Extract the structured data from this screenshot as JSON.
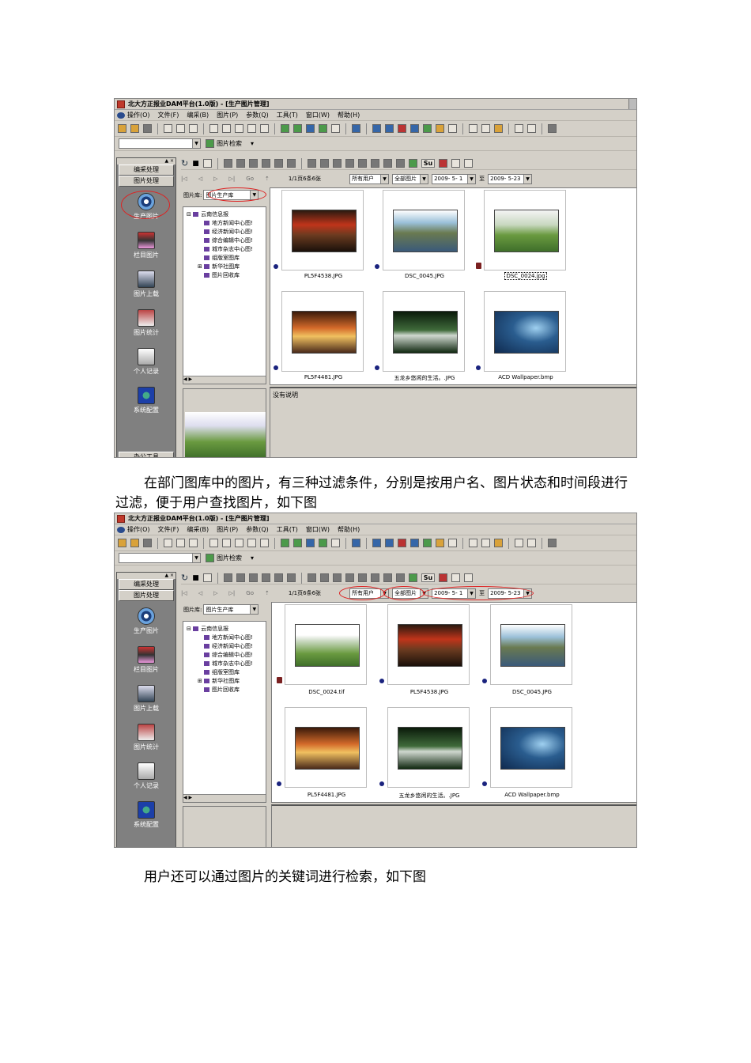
{
  "shot1": {
    "title": "北大方正报业DAM平台(1.0版) - [生产图片管理]",
    "menus": [
      "操作(O)",
      "文件(F)",
      "编采(B)",
      "图片(P)",
      "参数(Q)",
      "工具(T)",
      "窗口(W)",
      "帮助(H)"
    ],
    "search_button": "图片检索",
    "tabs": [
      "编采处理",
      "图片处理"
    ],
    "nav": [
      "生产图片",
      "栏目图片",
      "图片上载",
      "图片统计",
      "个人记录",
      "系统配置"
    ],
    "office_tools": "办公工具",
    "go_label": "Go",
    "page_info": "1/1页6条6张",
    "filter_user": "所有用户",
    "filter_state": "全部图片",
    "date_from": "2009- 5- 1",
    "date_to_label": "至",
    "date_to": "2009- 5-23",
    "library_label": "图片库:",
    "library_value": "图片生产库",
    "tree_root": "云南信息报",
    "tree_items": [
      "地方新闻中心图!",
      "经济新闻中心图!",
      "综合编辑中心图!",
      "城市杂志中心图!",
      "组版室图库",
      "新华社图库",
      "图片回收库"
    ],
    "thumbs": [
      "PL5F4538.JPG",
      "DSC_0045.JPG",
      "DSC_0024.jpg",
      "PL5F4481.JPG",
      "五龙乡悠闲的生活。.JPG",
      "ACD Wallpaper.bmp"
    ],
    "desc": "没有说明"
  },
  "para1": "在部门图库中的图片，有三种过滤条件，分别是按用户名、图片状态和时间段进行过滤，便于用户查找图片，如下图",
  "shot2": {
    "title": "北大方正报业DAM平台(1.0版) - [生产图片管理]",
    "menus": [
      "操作(O)",
      "文件(F)",
      "编采(B)",
      "图片(P)",
      "参数(Q)",
      "工具(T)",
      "窗口(W)",
      "帮助(H)"
    ],
    "search_button": "图片检索",
    "tabs": [
      "编采处理",
      "图片处理"
    ],
    "nav": [
      "生产图片",
      "栏目图片",
      "图片上载",
      "图片统计",
      "个人记录",
      "系统配置"
    ],
    "go_label": "Go",
    "page_info": "1/1页6条6张",
    "filter_user": "所有用户",
    "filter_state": "全部图片",
    "date_from": "2009- 5- 1",
    "date_to_label": "至",
    "date_to": "2009- 5-23",
    "library_label": "图片库:",
    "library_value": "图片生产库",
    "tree_root": "云南信息报",
    "tree_items": [
      "地方新闻中心图!",
      "经济新闻中心图!",
      "综合编辑中心图!",
      "城市杂志中心图!",
      "组版室图库",
      "新华社图库",
      "图片回收库"
    ],
    "thumbs": [
      "DSC_0024.tif",
      "PL5F4538.JPG",
      "DSC_0045.JPG",
      "PL5F4481.JPG",
      "五龙乡悠闲的生活。.JPG",
      "ACD Wallpaper.bmp"
    ]
  },
  "para2": "用户还可以通过图片的关键词进行检索，如下图"
}
